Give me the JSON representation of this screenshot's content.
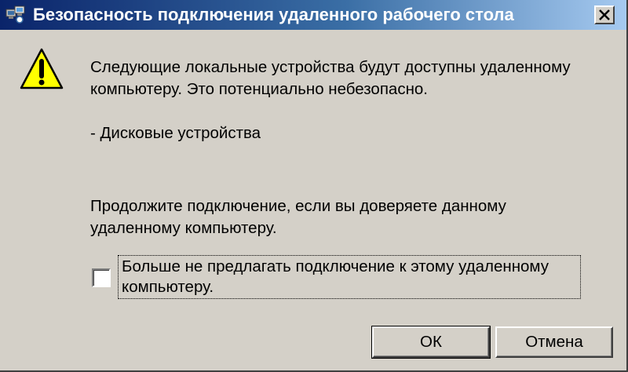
{
  "window": {
    "title": "Безопасность подключения удаленного рабочего стола"
  },
  "message": {
    "line1": "Следующие локальные устройства будут доступны удаленному",
    "line2": "компьютеру. Это потенциально небезопасно.",
    "device": "- Дисковые устройства",
    "prompt_line1": "Продолжите подключение, если вы доверяете данному",
    "prompt_line2": "удаленному компьютеру."
  },
  "checkbox": {
    "label_line1": "Больше не предлагать подключение к этому удаленному",
    "label_line2": "компьютеру.",
    "checked": false
  },
  "buttons": {
    "ok": "ОК",
    "cancel": "Отмена"
  },
  "icons": {
    "title": "remote-desktop-icon",
    "warning": "warning-icon",
    "close": "close-icon"
  },
  "colors": {
    "titlebar_start": "#0a246a",
    "titlebar_end": "#a6caf0",
    "face": "#d4d0c8",
    "warning_yellow": "#ffff00"
  }
}
